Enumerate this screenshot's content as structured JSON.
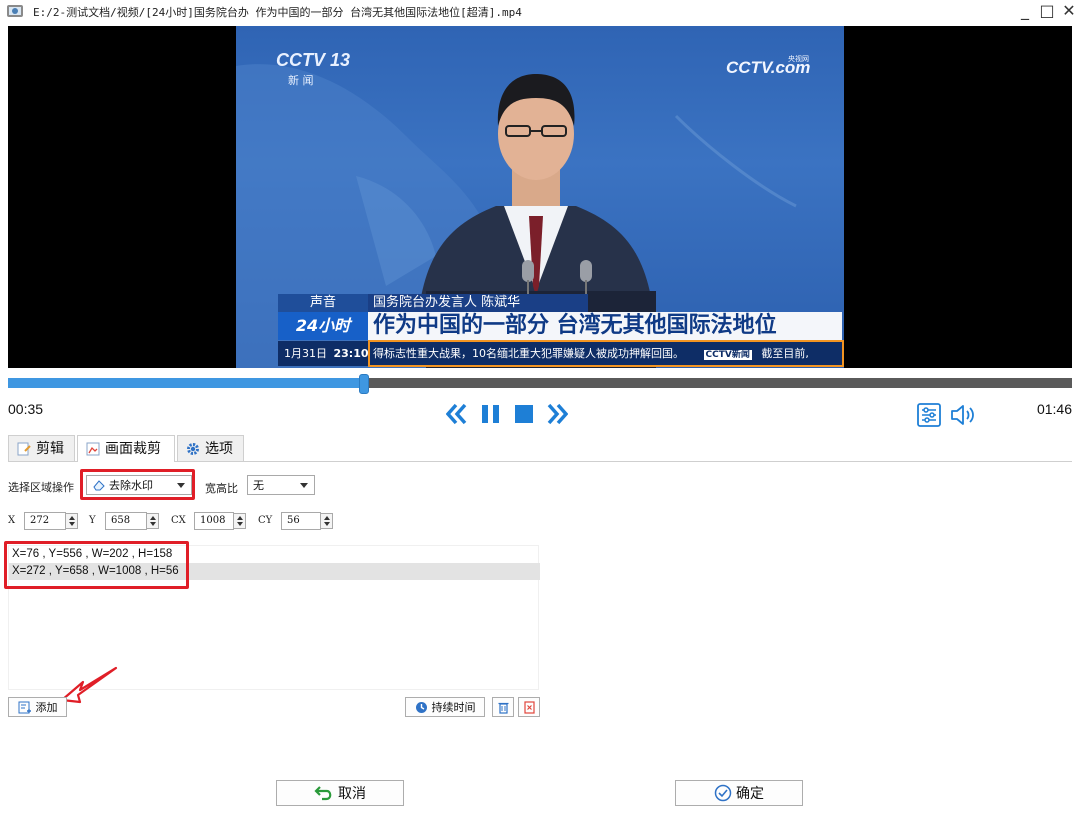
{
  "window": {
    "title": "E:/2-测试文档/视频/[24小时]国务院台办 作为中国的一部分 台湾无其他国际法地位[超清].mp4",
    "minimize": "_",
    "maximize": "□",
    "close": "✕"
  },
  "video": {
    "channel_logo": "CCTV 13",
    "channel_sub": "新 闻",
    "site_logo": "CCTV.com",
    "site_sub": "央视网",
    "caption_tag": "声音",
    "caption_speaker": "国务院台办发言人 陈斌华",
    "program_tag": "24小时",
    "headline": "作为中国的一部分 台湾无其他国际法地位",
    "date": "1月31日",
    "clock": "23:10",
    "ticker": "得标志性重大战果，10名缅北重大犯罪嫌疑人被成功押解回国。",
    "ticker_logo": "CCTV新闻",
    "ticker_tail": "截至目前,",
    "progress_fraction": 0.335
  },
  "player": {
    "time_current": "00:35",
    "time_total": "01:46"
  },
  "tabs": [
    {
      "label": "剪辑"
    },
    {
      "label": "画面裁剪"
    },
    {
      "label": "选项"
    }
  ],
  "crop": {
    "region_op_label": "选择区域操作",
    "region_op_value": "去除水印",
    "aspect_label": "宽高比",
    "aspect_value": "无",
    "x_label": "X",
    "x_value": "272",
    "y_label": "Y",
    "y_value": "658",
    "cx_label": "CX",
    "cx_value": "1008",
    "cy_label": "CY",
    "cy_value": "56",
    "regions": [
      "X=76 , Y=556 , W=202 , H=158",
      "X=272 , Y=658 , W=1008 , H=56"
    ],
    "add_label": "添加",
    "duration_label": "持续时间"
  },
  "footer": {
    "cancel_label": "取消",
    "ok_label": "确定"
  },
  "colors": {
    "accent": "#1e7fd6",
    "highlight": "#e01e27"
  }
}
